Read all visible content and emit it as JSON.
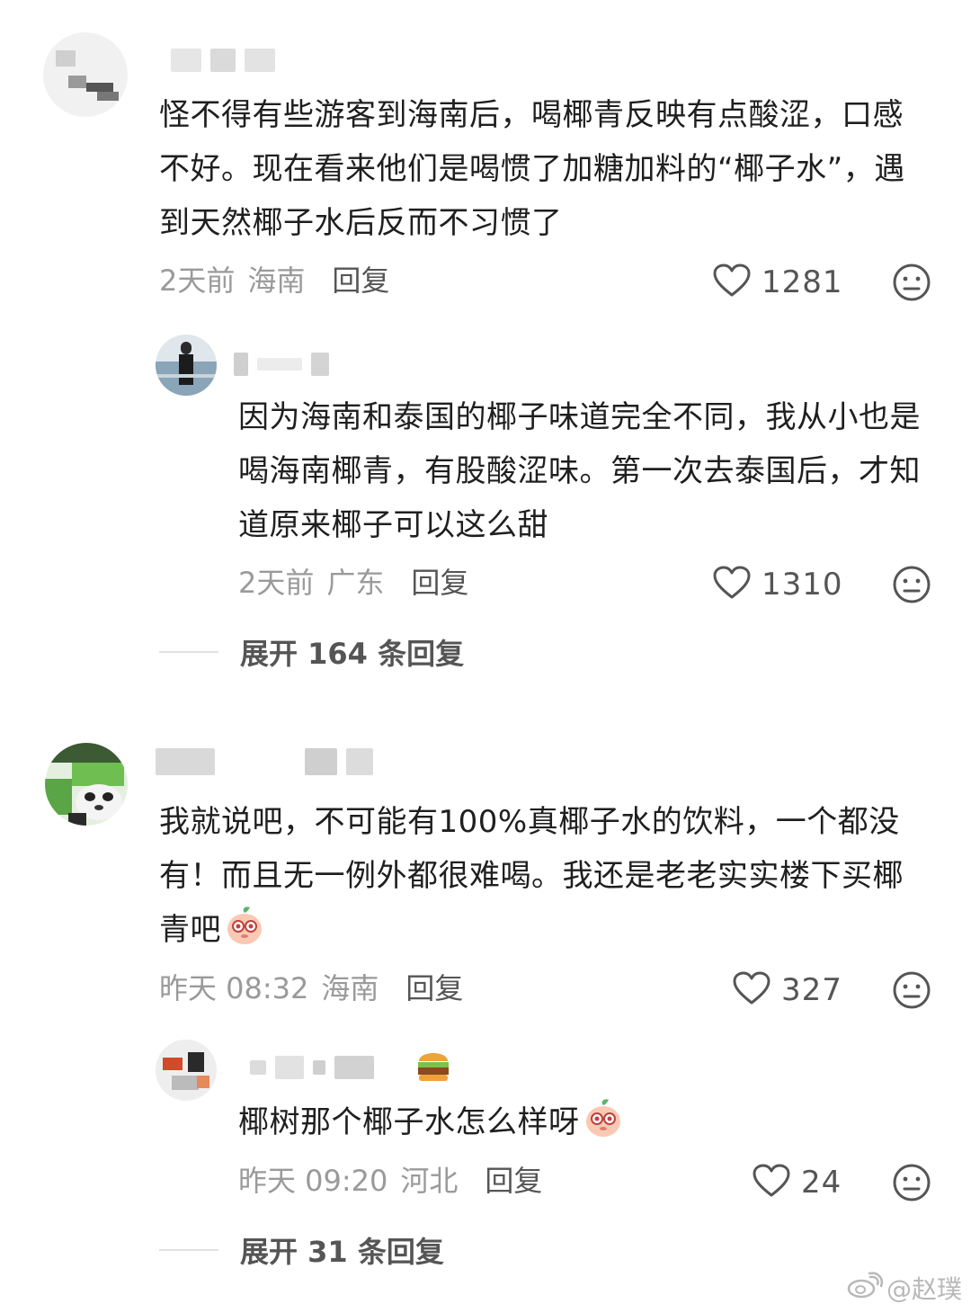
{
  "comments": [
    {
      "text": "怪不得有些游客到海南后，喝椰青反映有点酸涩，口感不好。现在看来他们是喝惯了加糖加料的“椰子水”，遇到天然椰子水后反而不习惯了",
      "time": "2天前",
      "location": "海南",
      "reply_label": "回复",
      "likes": "1281",
      "replies": [
        {
          "text": "因为海南和泰国的椰子味道完全不同，我从小也是喝海南椰青，有股酸涩味。第一次去泰国后，才知道原来椰子可以这么甜",
          "time": "2天前",
          "location": "广东",
          "reply_label": "回复",
          "likes": "1310"
        }
      ],
      "expand_label": "展开 164 条回复"
    },
    {
      "text": "我就说吧，不可能有100%真椰子水的饮料，一个都没有！而且无一例外都很难喝。我还是老老实实楼下买椰青吧",
      "time": "昨天 08:32",
      "location": "海南",
      "reply_label": "回复",
      "likes": "327",
      "replies": [
        {
          "text": "椰树那个椰子水怎么样呀",
          "time": "昨天 09:20",
          "location": "河北",
          "reply_label": "回复",
          "likes": "24"
        }
      ],
      "expand_label": "展开 31 条回复"
    }
  ],
  "watermark": "@赵璞",
  "icons": {
    "like": "heart-outline-icon",
    "dislike": "neutral-face-icon",
    "emoji": "peach-face-emoji"
  }
}
